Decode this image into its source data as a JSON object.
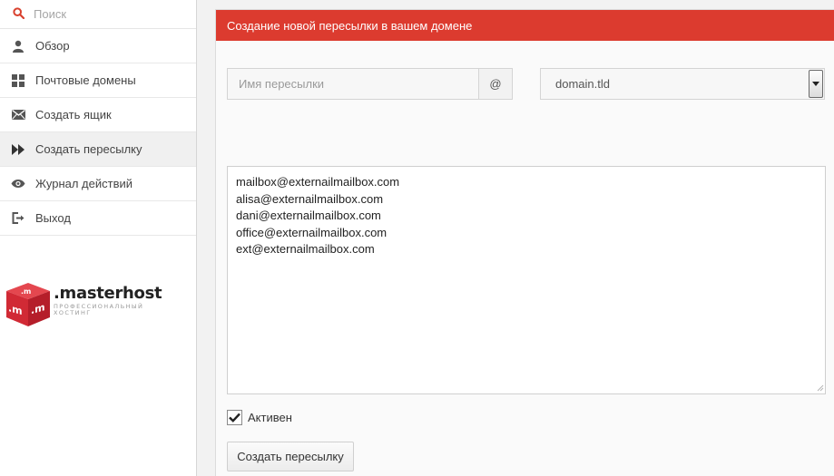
{
  "search": {
    "placeholder": "Поиск"
  },
  "sidebar": {
    "items": [
      {
        "label": "Обзор",
        "icon": "user-icon"
      },
      {
        "label": "Почтовые домены",
        "icon": "grid-icon"
      },
      {
        "label": "Создать ящик",
        "icon": "envelope-icon"
      },
      {
        "label": "Создать пересылку",
        "icon": "fast-forward-icon",
        "active": true
      },
      {
        "label": "Журнал действий",
        "icon": "eye-icon"
      },
      {
        "label": "Выход",
        "icon": "logout-icon"
      }
    ]
  },
  "logo": {
    "cube_text": ".m",
    "name": ".masterhost",
    "tagline": "профессиональный хостинг"
  },
  "form": {
    "title": "Создание новой пересылки в вашем домене",
    "alias_placeholder": "Имя пересылки",
    "at_symbol": "@",
    "domain_selected": "domain.tld",
    "targets": [
      "mailbox@externailmailbox.com",
      "alisa@externailmailbox.com",
      "dani@externailmailbox.com",
      "office@externailmailbox.com",
      "ext@externailmailbox.com"
    ],
    "active_label": "Активен",
    "active_checked": true,
    "submit_label": "Создать пересылку"
  },
  "colors": {
    "header_red": "#dc3b2f",
    "search_icon_red": "#d9412e",
    "logo_red": "#d12a35"
  }
}
